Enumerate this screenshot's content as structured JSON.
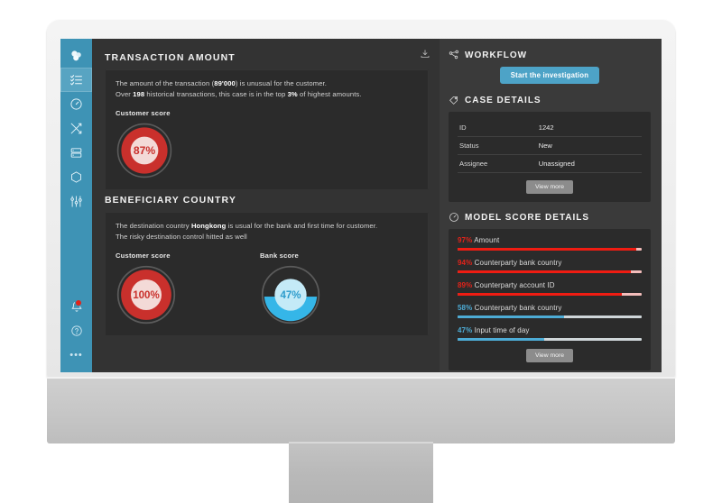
{
  "sidebar": {
    "items": [
      {
        "id": "logo",
        "icon": "app-logo-icon",
        "label": "Logo",
        "active": false
      },
      {
        "id": "cases",
        "icon": "checklist-icon",
        "label": "Cases",
        "active": true
      },
      {
        "id": "performance",
        "icon": "gauge-icon",
        "label": "Performance",
        "active": false
      },
      {
        "id": "rules",
        "icon": "shuffle-icon",
        "label": "Rules",
        "active": false
      },
      {
        "id": "data",
        "icon": "database-icon",
        "label": "Data",
        "active": false
      },
      {
        "id": "models",
        "icon": "hexagon-icon",
        "label": "Models",
        "active": false
      },
      {
        "id": "settings",
        "icon": "sliders-icon",
        "label": "Settings",
        "active": false
      }
    ],
    "bottom": [
      {
        "id": "alerts",
        "icon": "bell-icon",
        "label": "Alerts",
        "badge": true
      },
      {
        "id": "help",
        "icon": "help-circle-icon",
        "label": "Help",
        "badge": false
      },
      {
        "id": "more",
        "icon": "ellipsis-icon",
        "label": "More",
        "badge": false
      }
    ],
    "accent": "#3e93b5",
    "accent_active": "#58a4c2"
  },
  "main": {
    "download_icon": "download-icon",
    "sections": [
      {
        "title": "TRANSACTION AMOUNT",
        "lines": [
          {
            "pre": "The amount of the transaction (",
            "bold": "89'000",
            "post": ") is unusual for the customer."
          },
          {
            "pre": "Over ",
            "bold": "198",
            "mid": " historical transactions, this case is in the top ",
            "bold2": "3%",
            "post": " of highest amounts."
          }
        ],
        "gauges": [
          {
            "label": "Customer score",
            "value": 87,
            "display": "87%",
            "type": "ring",
            "color": "#c9302c"
          }
        ]
      },
      {
        "title": "BENEFICIARY COUNTRY",
        "lines": [
          {
            "pre": "The destination country ",
            "bold": "Hongkong",
            "post": " is usual for the bank and first time for customer."
          },
          {
            "pre": "The risky destination control hitted as well",
            "bold": "",
            "post": ""
          }
        ],
        "gauges": [
          {
            "label": "Customer score",
            "value": 100,
            "display": "100%",
            "type": "ring",
            "color": "#c9302c"
          },
          {
            "label": "Bank score",
            "value": 47,
            "display": "47%",
            "type": "liquid",
            "color": "#35b6e8"
          }
        ]
      }
    ]
  },
  "right": {
    "workflow": {
      "icon": "workflow-nodes-icon",
      "title": "WORKFLOW",
      "button": "Start the investigation"
    },
    "case_details": {
      "icon": "tag-icon",
      "title": "CASE DETAILS",
      "rows": [
        {
          "key": "ID",
          "value": "1242"
        },
        {
          "key": "Status",
          "value": "New"
        },
        {
          "key": "Assignee",
          "value": "Unassigned"
        }
      ],
      "view_more": "View more"
    },
    "model_score": {
      "icon": "speedometer-icon",
      "title": "MODEL SCORE DETAILS",
      "items": [
        {
          "pct": "97%",
          "value": 97,
          "name": "Amount",
          "tone": "red"
        },
        {
          "pct": "94%",
          "value": 94,
          "name": "Counterparty bank country",
          "tone": "red"
        },
        {
          "pct": "89%",
          "value": 89,
          "name": "Counterparty account ID",
          "tone": "red"
        },
        {
          "pct": "58%",
          "value": 58,
          "name": "Counterparty bank country",
          "tone": "blue"
        },
        {
          "pct": "47%",
          "value": 47,
          "name": "Input time of day",
          "tone": "blue"
        }
      ],
      "view_more": "View more"
    }
  },
  "colors": {
    "accent_blue": "#4da3c7",
    "danger_red": "#e2231a",
    "screen_bg": "#333333",
    "panel_bg": "#3a3a3a",
    "card_bg": "#2b2b2b"
  }
}
